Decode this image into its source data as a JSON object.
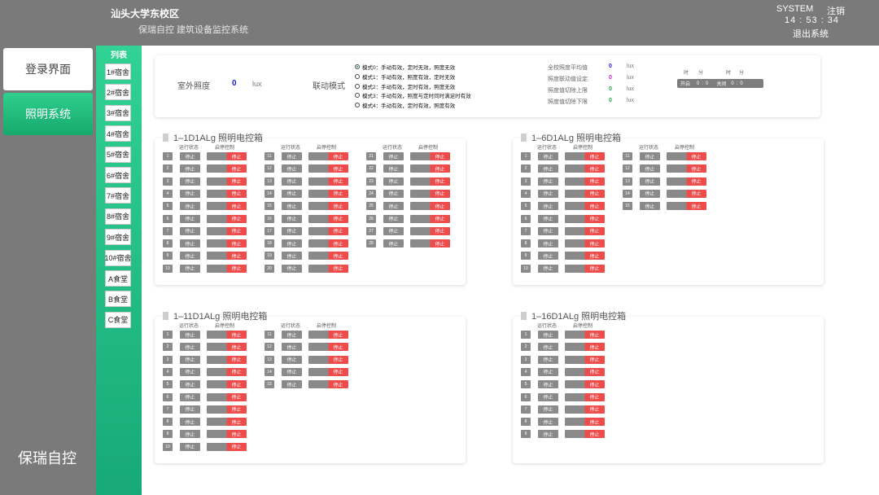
{
  "header": {
    "campus": "汕头大学东校区",
    "subtitle": "保瑞自控 建筑设备监控系统",
    "user": "SYSTEM",
    "logout": "注销",
    "time": "14 : 53 : 34",
    "exit": "退出系统"
  },
  "nav": {
    "login": "登录界面",
    "lighting": "照明系统",
    "brand": "保瑞自控"
  },
  "list": {
    "title": "列表",
    "items": [
      "1#宿舍",
      "2#宿舍",
      "3#宿舍",
      "4#宿舍",
      "5#宿舍",
      "6#宿舍",
      "7#宿舍",
      "8#宿舍",
      "9#宿舍",
      "10#宿舍",
      "A食堂",
      "B食堂",
      "C食堂"
    ]
  },
  "top": {
    "outdoor_label": "室外照度",
    "outdoor_value": "0",
    "outdoor_unit": "lux",
    "linkage_label": "联动模式",
    "modes": [
      "模式0：手动有效，定时无效，照度无效",
      "模式1：手动有效，照度有效，定时无效",
      "模式2：手动有效，定时有效，照度无效",
      "模式3：手动有效，照度与定时同时满足时有效",
      "模式4：手动有效，定时有效，照度有效"
    ],
    "selected_mode_index": 0,
    "stats": [
      {
        "label": "全校照度平均值",
        "value": "0",
        "unit": "lux",
        "color": "#2020d0"
      },
      {
        "label": "照度联动值设定",
        "value": "0",
        "unit": "lux",
        "color": "#c020c0"
      },
      {
        "label": "照度值切除上限",
        "value": "0",
        "unit": "lux",
        "color": "#20a040"
      },
      {
        "label": "照度值切除下限",
        "value": "0",
        "unit": "lux",
        "color": "#20a040"
      }
    ],
    "timer": {
      "hour_label": "时",
      "minute_label": "分",
      "on_label": "开启",
      "on_hour": "0",
      "on_minute": "0",
      "off_label": "关闭",
      "off_hour": "0",
      "off_minute": "0"
    }
  },
  "labels": {
    "run_status": "运行状态",
    "start_stop": "启停控制",
    "stopped": "停止"
  },
  "panels": [
    {
      "title": "1–1D1ALg 照明电控箱",
      "count": 28
    },
    {
      "title": "1–6D1ALg 照明电控箱",
      "count": 15
    },
    {
      "title": "1–11D1ALg 照明电控箱",
      "count": 15
    },
    {
      "title": "1–16D1ALg 照明电控箱",
      "count": 9
    }
  ]
}
